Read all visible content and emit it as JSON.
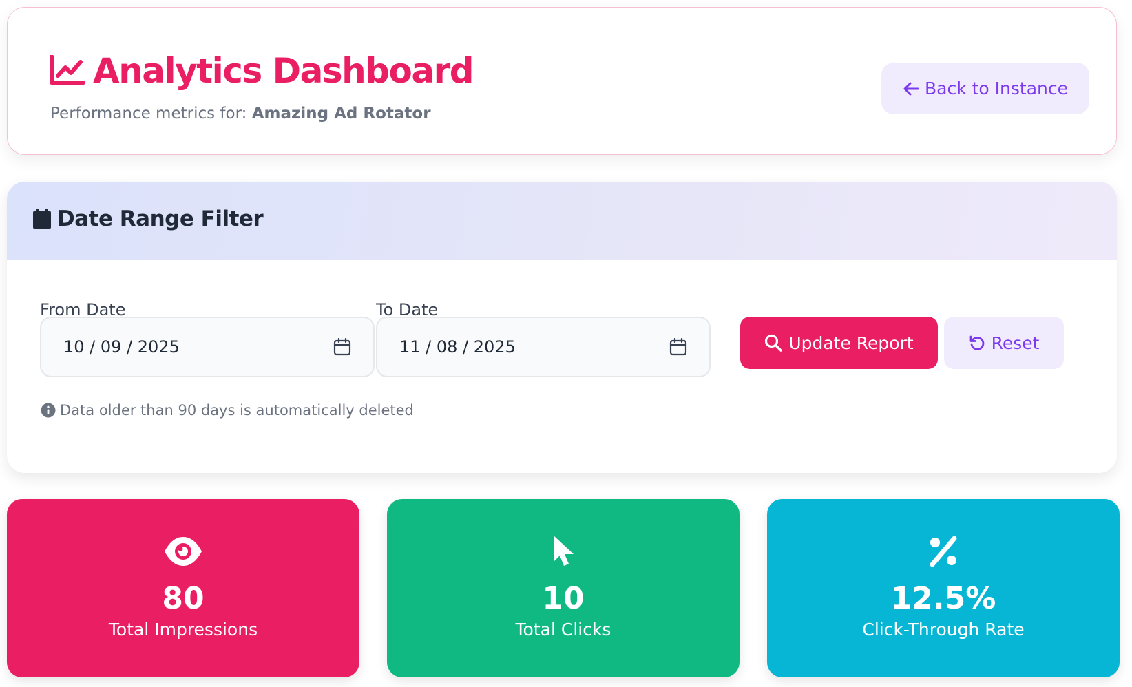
{
  "header": {
    "title": "Analytics Dashboard",
    "subtitle_prefix": "Performance metrics for:",
    "instance_name": "Amazing Ad Rotator",
    "back_button": "Back to Instance",
    "accent_color": "#e91e63"
  },
  "filter": {
    "title": "Date Range Filter",
    "from_label": "From Date",
    "from_value": "10 / 09 / 2025",
    "to_label": "To Date",
    "to_value": "11 / 08 / 2025",
    "update_button": "Update Report",
    "reset_button": "Reset",
    "note": "Data older than 90 days is automatically deleted"
  },
  "stats": [
    {
      "value": "80",
      "label": "Total Impressions",
      "icon": "eye-icon",
      "color": "#e91e63"
    },
    {
      "value": "10",
      "label": "Total Clicks",
      "icon": "cursor-icon",
      "color": "#10b981"
    },
    {
      "value": "12.5%",
      "label": "Click-Through Rate",
      "icon": "percent-icon",
      "color": "#06b6d4"
    }
  ]
}
